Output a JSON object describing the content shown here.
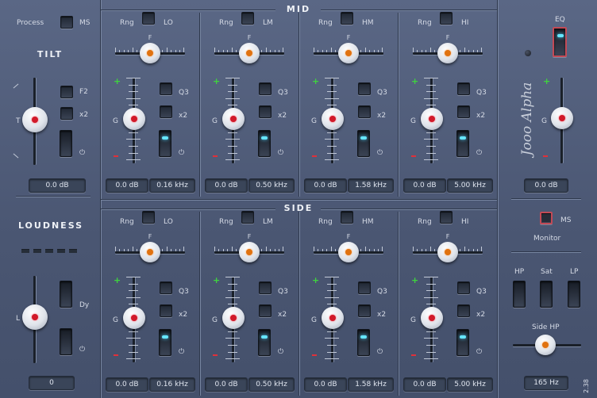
{
  "header": {
    "mid_label": "MID",
    "side_label": "SIDE"
  },
  "left": {
    "process_label": "Process",
    "ms_label": "MS",
    "tilt_title": "TILT",
    "tilt_knob_label": "T",
    "f2_label": "F2",
    "x2_label": "x2",
    "power_icon": "⏻",
    "tilt_value": "0.0 dB",
    "loudness_title": "LOUDNESS",
    "loudness_knob_label": "L",
    "dy_label": "Dy",
    "loudness_value": "0"
  },
  "mid": {
    "bands": [
      {
        "range_label": "Rng",
        "band": "LO",
        "f_label": "F",
        "g_label": "G",
        "q_label": "Q3",
        "x2_label": "x2",
        "gain": "0.0 dB",
        "freq": "0.16 kHz"
      },
      {
        "range_label": "Rng",
        "band": "LM",
        "f_label": "F",
        "g_label": "G",
        "q_label": "Q3",
        "x2_label": "x2",
        "gain": "0.0 dB",
        "freq": "0.50 kHz"
      },
      {
        "range_label": "Rng",
        "band": "HM",
        "f_label": "F",
        "g_label": "G",
        "q_label": "Q3",
        "x2_label": "x2",
        "gain": "0.0 dB",
        "freq": "1.58 kHz"
      },
      {
        "range_label": "Rng",
        "band": "HI",
        "f_label": "F",
        "g_label": "G",
        "q_label": "Q3",
        "x2_label": "x2",
        "gain": "0.0 dB",
        "freq": "5.00 kHz"
      }
    ]
  },
  "side": {
    "bands": [
      {
        "range_label": "Rng",
        "band": "LO",
        "f_label": "F",
        "g_label": "G",
        "q_label": "Q3",
        "x2_label": "x2",
        "gain": "0.0 dB",
        "freq": "0.16 kHz"
      },
      {
        "range_label": "Rng",
        "band": "LM",
        "f_label": "F",
        "g_label": "G",
        "q_label": "Q3",
        "x2_label": "x2",
        "gain": "0.0 dB",
        "freq": "0.50 kHz"
      },
      {
        "range_label": "Rng",
        "band": "HM",
        "f_label": "F",
        "g_label": "G",
        "q_label": "Q3",
        "x2_label": "x2",
        "gain": "0.0 dB",
        "freq": "1.58 kHz"
      },
      {
        "range_label": "Rng",
        "band": "HI",
        "f_label": "F",
        "g_label": "G",
        "q_label": "Q3",
        "x2_label": "x2",
        "gain": "0.0 dB",
        "freq": "5.00 kHz"
      }
    ]
  },
  "right": {
    "eq_label": "EQ",
    "logo_text": "Jooo Alpha",
    "g_label": "G",
    "output_value": "0.0 dB",
    "ms_label": "MS",
    "monitor_label": "Monitor",
    "hp_label": "HP",
    "sat_label": "Sat",
    "lp_label": "LP",
    "side_hp_label": "Side HP",
    "side_hp_value": "165 Hz",
    "version": "2.38"
  },
  "colors": {
    "led_cyan": "#66e6ff",
    "knob_dot_red": "#d11a2a",
    "knob_dot_orange": "#e07210",
    "plus_green": "#3ed43e",
    "minus_red": "#e0303a",
    "highlight_red": "#c24a56"
  }
}
